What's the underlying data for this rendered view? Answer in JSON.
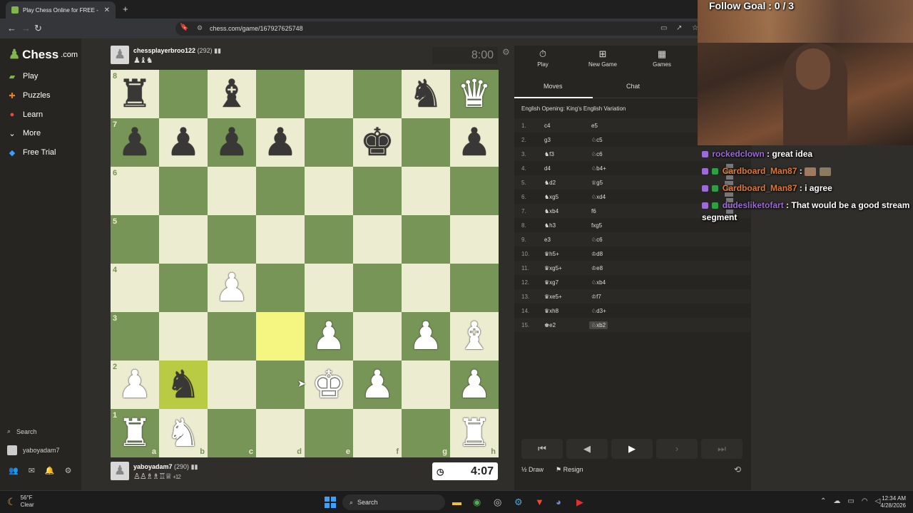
{
  "browser": {
    "tab_title": "Play Chess Online for FREE -",
    "url": "chess.com/game/167927625748"
  },
  "sidebar": {
    "logo": "Chess",
    "logo_suffix": ".com",
    "items": [
      {
        "label": "Play",
        "icon": "play-icon",
        "color": "#81b64c"
      },
      {
        "label": "Puzzles",
        "icon": "puzzle-icon",
        "color": "#e67e22"
      },
      {
        "label": "Learn",
        "icon": "learn-icon",
        "color": "#e74c3c"
      },
      {
        "label": "More",
        "icon": "chevron-down-icon",
        "color": "#ffffff"
      },
      {
        "label": "Free Trial",
        "icon": "diamond-icon",
        "color": "#3aa0ff"
      }
    ],
    "search_label": "Search",
    "username": "yaboyadam7"
  },
  "top_player": {
    "name": "chessplayerbroo122",
    "rating": "(292)",
    "captured": "♟♝♞",
    "clock": "8:00"
  },
  "bottom_player": {
    "name": "yaboyadam7",
    "rating": "(290)",
    "captured": "♙♙♗♗♖♕",
    "advantage": "+12",
    "clock": "4:07"
  },
  "board": {
    "ranks": [
      "8",
      "7",
      "6",
      "5",
      "4",
      "3",
      "2",
      "1"
    ],
    "files": [
      "a",
      "b",
      "c",
      "d",
      "e",
      "f",
      "g",
      "h"
    ],
    "highlight_yellow": "d3",
    "highlight_green": "b2",
    "pieces": [
      {
        "sq": "a8",
        "glyph": "♜",
        "color": "b"
      },
      {
        "sq": "c8",
        "glyph": "♝",
        "color": "b"
      },
      {
        "sq": "g8",
        "glyph": "♞",
        "color": "b"
      },
      {
        "sq": "h8",
        "glyph": "♛",
        "color": "w"
      },
      {
        "sq": "a7",
        "glyph": "♟",
        "color": "b"
      },
      {
        "sq": "b7",
        "glyph": "♟",
        "color": "b"
      },
      {
        "sq": "c7",
        "glyph": "♟",
        "color": "b"
      },
      {
        "sq": "d7",
        "glyph": "♟",
        "color": "b"
      },
      {
        "sq": "f7",
        "glyph": "♚",
        "color": "b"
      },
      {
        "sq": "h7",
        "glyph": "♟",
        "color": "b"
      },
      {
        "sq": "c4",
        "glyph": "♟",
        "color": "w"
      },
      {
        "sq": "e3",
        "glyph": "♟",
        "color": "w"
      },
      {
        "sq": "g3",
        "glyph": "♟",
        "color": "w"
      },
      {
        "sq": "h3",
        "glyph": "♝",
        "color": "w"
      },
      {
        "sq": "a2",
        "glyph": "♟",
        "color": "w"
      },
      {
        "sq": "b2",
        "glyph": "♞",
        "color": "b"
      },
      {
        "sq": "e2",
        "glyph": "♚",
        "color": "w"
      },
      {
        "sq": "f2",
        "glyph": "♟",
        "color": "w"
      },
      {
        "sq": "h2",
        "glyph": "♟",
        "color": "w"
      },
      {
        "sq": "a1",
        "glyph": "♜",
        "color": "w"
      },
      {
        "sq": "b1",
        "glyph": "♞",
        "color": "w"
      },
      {
        "sq": "h1",
        "glyph": "♜",
        "color": "w"
      }
    ]
  },
  "panel": {
    "tabs": [
      {
        "label": "Play",
        "icon": "stopwatch-icon"
      },
      {
        "label": "New Game",
        "icon": "plus-icon"
      },
      {
        "label": "Games",
        "icon": "board-icon"
      }
    ],
    "subtabs": [
      "Moves",
      "Chat"
    ],
    "opening": "English Opening: King's English Variation",
    "moves": [
      {
        "n": "1.",
        "w": "c4",
        "b": "e5"
      },
      {
        "n": "2.",
        "w": "g3",
        "b": "♘c5"
      },
      {
        "n": "3.",
        "w": "♞f3",
        "b": "♘c6"
      },
      {
        "n": "4.",
        "w": "d4",
        "b": "♘b4+"
      },
      {
        "n": "5.",
        "w": "♞d2",
        "b": "♕g5"
      },
      {
        "n": "6.",
        "w": "♞xg5",
        "b": "♘xd4"
      },
      {
        "n": "7.",
        "w": "♞xb4",
        "b": "f6"
      },
      {
        "n": "8.",
        "w": "♞h3",
        "b": "fxg5"
      },
      {
        "n": "9.",
        "w": "e3",
        "b": "♘c6"
      },
      {
        "n": "10.",
        "w": "♛h5+",
        "b": "♔d8"
      },
      {
        "n": "11.",
        "w": "♛xg5+",
        "b": "♔e8"
      },
      {
        "n": "12.",
        "w": "♛xg7",
        "b": "♘xb4"
      },
      {
        "n": "13.",
        "w": "♛xe5+",
        "b": "♔f7"
      },
      {
        "n": "14.",
        "w": "♛xh8",
        "b": "♘d3+"
      },
      {
        "n": "15.",
        "w": "♚e2",
        "b": "♘xb2"
      }
    ],
    "controls": [
      "⏮",
      "◀",
      "▶",
      "▶",
      "⏭"
    ],
    "draw_label": "Draw",
    "resign_label": "Resign"
  },
  "stream": {
    "goal": "Follow Goal : 0 / 3",
    "chat": [
      {
        "user": "rockedclown",
        "msg": ": great idea",
        "color": "#9b6bd6"
      },
      {
        "user": "Cardboard_Man87",
        "msg": ":",
        "color": "#e07a2e"
      },
      {
        "user": "Cardboard_Man87",
        "msg": ": i agree",
        "color": "#e07a2e"
      },
      {
        "user": "dudesliketofart",
        "msg": ": That would be a good stream segment",
        "color": "#9b6bd6"
      }
    ]
  },
  "taskbar": {
    "temp": "56°F",
    "weather": "Clear",
    "search": "Search",
    "time": "12:34 AM",
    "date": "4/28/2026"
  }
}
